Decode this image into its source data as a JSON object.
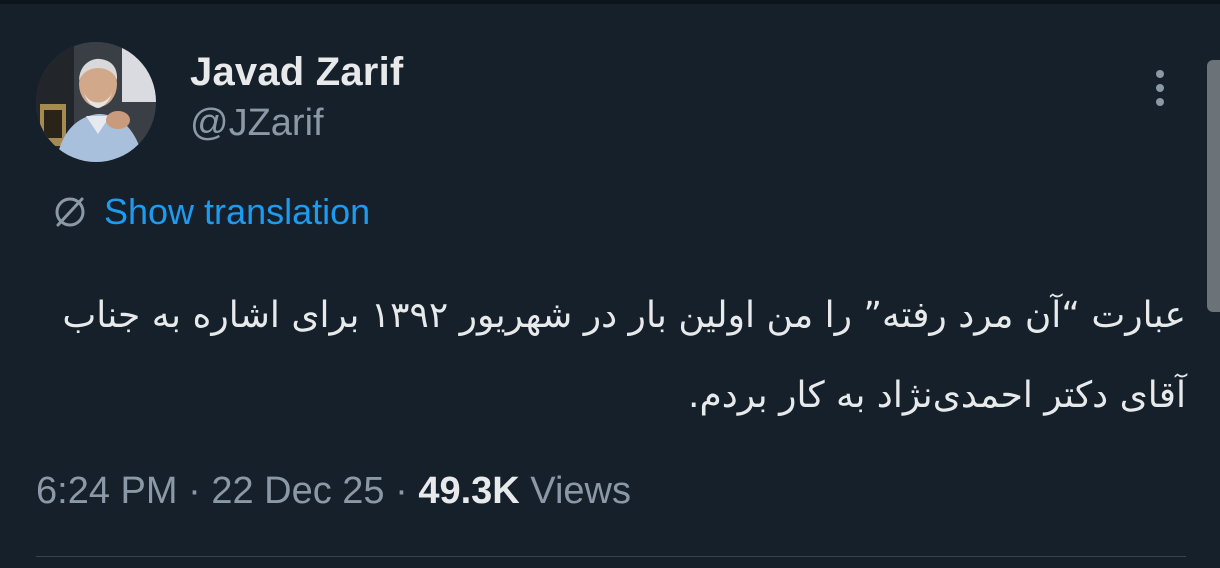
{
  "author": {
    "display_name": "Javad Zarif",
    "handle": "@JZarif",
    "avatar_icon": "profile-photo"
  },
  "menu": {
    "more_icon": "more-vertical-icon"
  },
  "translation": {
    "icon": "translate-globe-icon",
    "label": "Show translation"
  },
  "tweet": {
    "text": "عبارت “آن مرد رفته” را من اولین بار در شهریور ۱۳۹۲ برای اشاره به جناب آقای دکتر احمدی‌نژاد به کار بردم.",
    "direction": "rtl"
  },
  "meta": {
    "time": "6:24 PM",
    "separator": "·",
    "date": "22 Dec 25",
    "views_count": "49.3K",
    "views_label": "Views"
  },
  "colors": {
    "background": "#15202b",
    "primary_text": "#e7e9ea",
    "secondary_text": "#8b98a5",
    "link": "#1d9bf0",
    "divider": "#38444d"
  }
}
